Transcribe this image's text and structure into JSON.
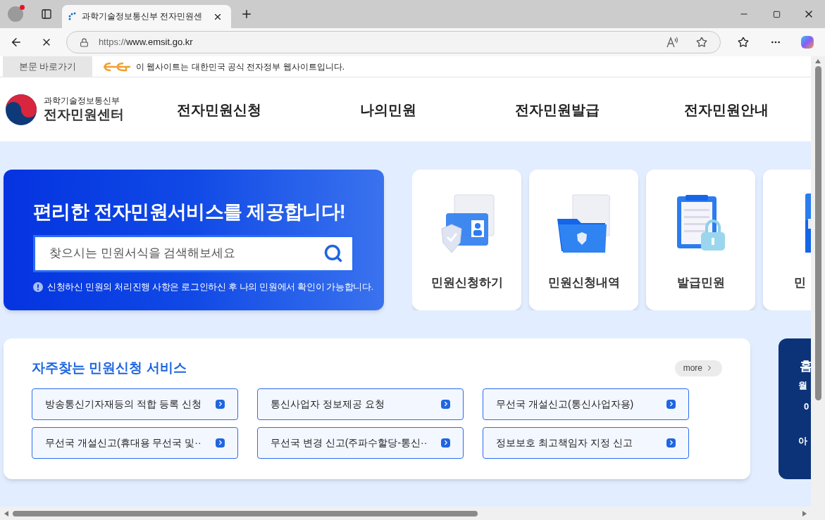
{
  "browser": {
    "tab_title": "과학기술정보통신부 전자민원센",
    "url_scheme": "https://",
    "url_host": "www.emsit.go.kr"
  },
  "skip_link": "본문 바로가기",
  "gov_notice": "이 웹사이트는 대한민국 공식 전자정부 웹사이트입니다.",
  "logo": {
    "ministry": "과학기술정보통신부",
    "center": "전자민원센터"
  },
  "nav": [
    "전자민원신청",
    "나의민원",
    "전자민원발급",
    "전자민원안내"
  ],
  "hero": {
    "title": "편리한 전자민원서비스를 제공합니다!",
    "search_placeholder": "찾으시는 민원서식을 검색해보세요",
    "notice": "신청하신 민원의 처리진행 사항은 로그인하신 후 나의 민원에서 확인이 가능합니다."
  },
  "quick_cards": [
    {
      "kind": "document",
      "label": "민원신청하기"
    },
    {
      "kind": "folder",
      "label": "민원신청내역"
    },
    {
      "kind": "clipboard",
      "label": "발급민원"
    },
    {
      "kind": "drawer",
      "label": "민"
    }
  ],
  "frequent": {
    "title": "자주찾는 민원신청 서비스",
    "more": "more",
    "items": [
      "방송통신기자재등의 적합 등록 신청",
      "통신사업자 정보제공 요청",
      "무선국 개설신고(통신사업자용)",
      "무선국 개설신고(휴대용 무선국 및··",
      "무선국 변경 신고(주파수할당-통신··",
      "정보보호 최고책임자 지정 신고"
    ]
  },
  "side_card": {
    "title": "홈",
    "lines": [
      "월",
      "0",
      "아"
    ]
  }
}
